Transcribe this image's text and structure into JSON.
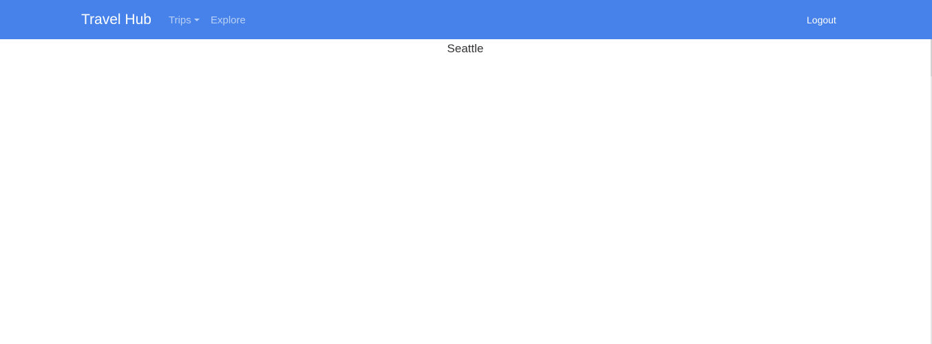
{
  "navbar": {
    "brand": "Travel Hub",
    "links": [
      {
        "label": "Trips",
        "has_dropdown": true
      },
      {
        "label": "Explore",
        "has_dropdown": false
      }
    ],
    "logout_label": "Logout",
    "background_color": "#4682e9"
  },
  "main": {
    "city": "Seattle"
  }
}
